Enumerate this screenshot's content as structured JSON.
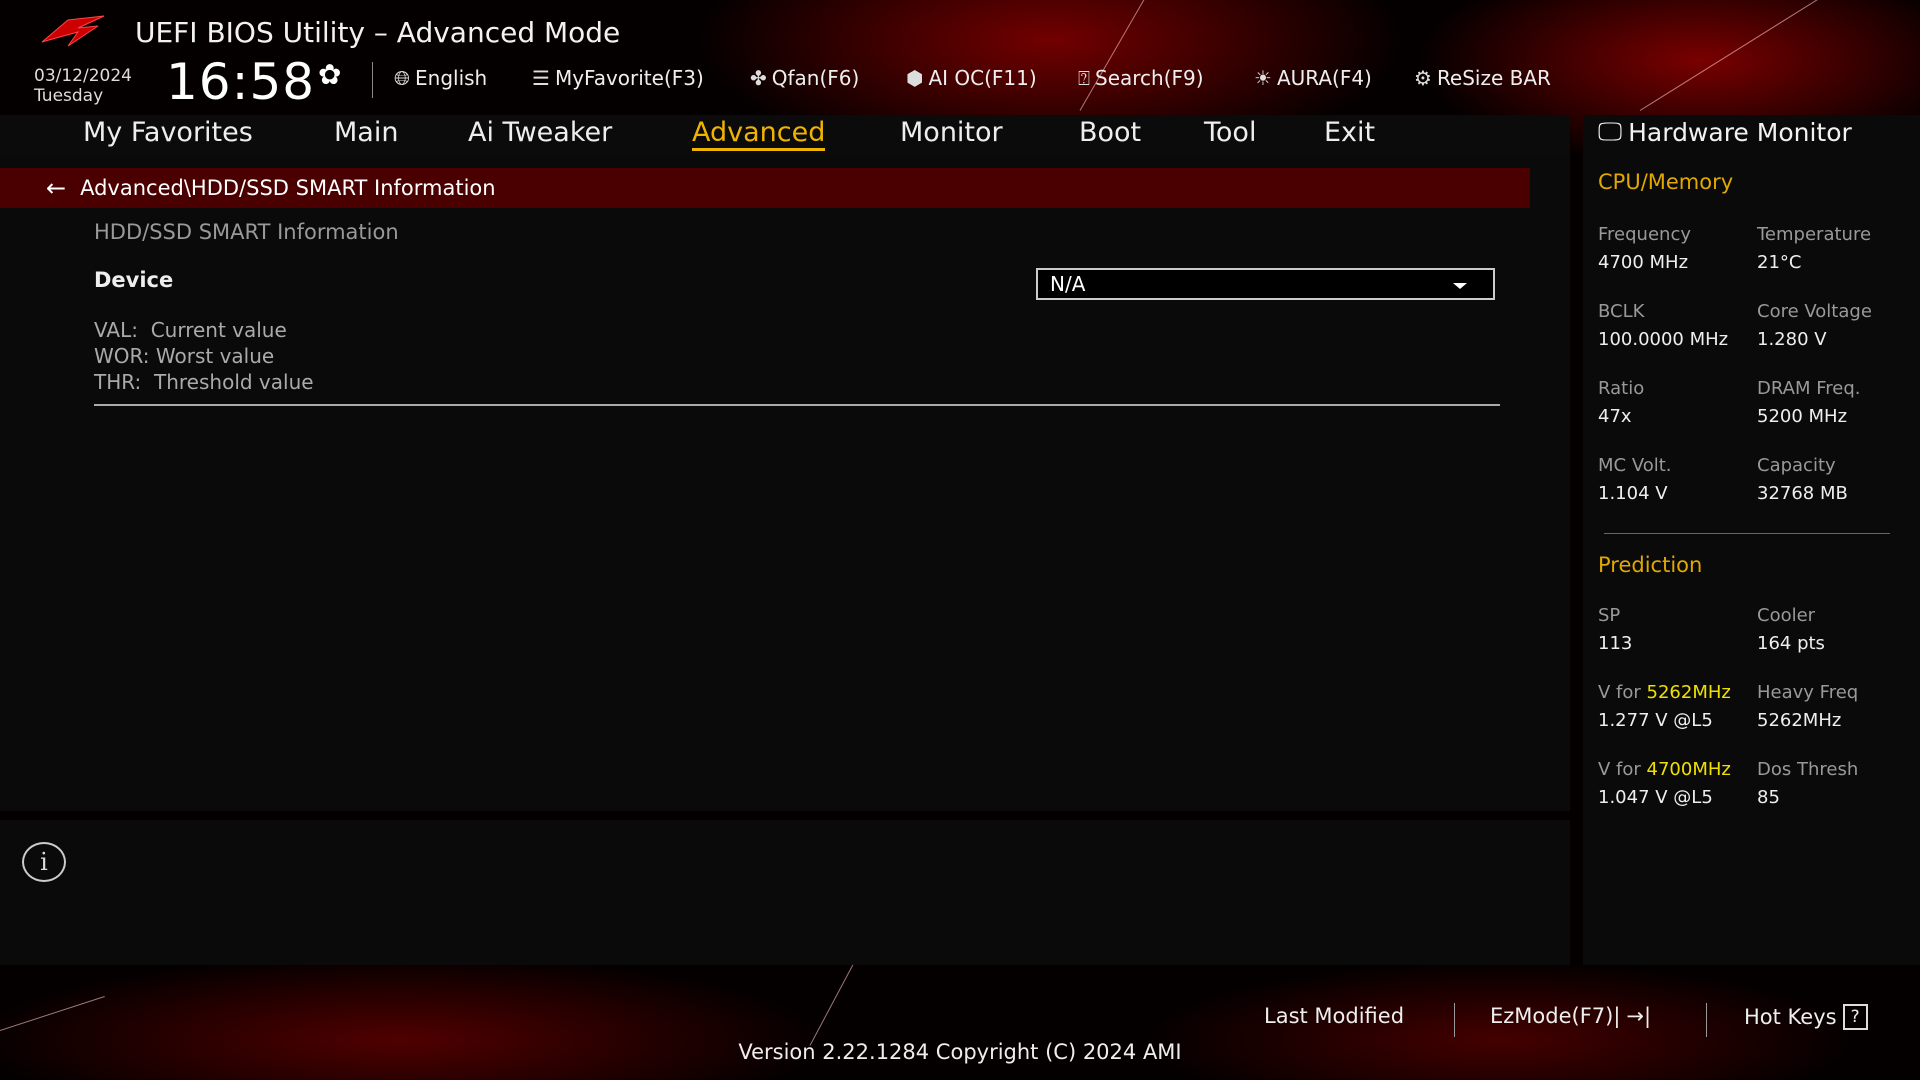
{
  "header": {
    "title": "UEFI BIOS Utility – Advanced Mode",
    "date": "03/12/2024",
    "day": "Tuesday",
    "time": "16:58"
  },
  "toolbar": [
    {
      "icon": "globe-icon",
      "label": "English"
    },
    {
      "icon": "favorite-icon",
      "label": "MyFavorite(F3)"
    },
    {
      "icon": "fan-icon",
      "label": "Qfan(F6)"
    },
    {
      "icon": "ai-oc-icon",
      "label": "AI OC(F11)"
    },
    {
      "icon": "search-icon",
      "label": "Search(F9)"
    },
    {
      "icon": "aura-icon",
      "label": "AURA(F4)"
    },
    {
      "icon": "resize-bar-icon",
      "label": "ReSize BAR"
    }
  ],
  "tabs": [
    "My Favorites",
    "Main",
    "Ai Tweaker",
    "Advanced",
    "Monitor",
    "Boot",
    "Tool",
    "Exit"
  ],
  "active_tab": "Advanced",
  "breadcrumb": "Advanced\\HDD/SSD SMART Information",
  "content": {
    "subtitle": "HDD/SSD SMART Information",
    "device_label": "Device",
    "device_value": "N/A",
    "legend": [
      {
        "k": "VAL:",
        "v": "Current value"
      },
      {
        "k": "WOR:",
        "v": "Worst value"
      },
      {
        "k": "THR:",
        "v": "Threshold value"
      }
    ]
  },
  "hw": {
    "title": "Hardware Monitor",
    "cpu_title": "CPU/Memory",
    "cpu": [
      {
        "l": "Frequency",
        "v": "4700 MHz"
      },
      {
        "l": "Temperature",
        "v": "21°C"
      },
      {
        "l": "BCLK",
        "v": "100.0000 MHz"
      },
      {
        "l": "Core Voltage",
        "v": "1.280 V"
      },
      {
        "l": "Ratio",
        "v": "47x"
      },
      {
        "l": "DRAM Freq.",
        "v": "5200 MHz"
      },
      {
        "l": "MC Volt.",
        "v": "1.104 V"
      },
      {
        "l": "Capacity",
        "v": "32768 MB"
      }
    ],
    "pred_title": "Prediction",
    "pred": {
      "sp_l": "SP",
      "sp_v": "113",
      "cooler_l": "Cooler",
      "cooler_v": "164 pts",
      "vfor": "V for ",
      "f1": "5262MHz",
      "v1": "1.277 V @L5",
      "heavy_l": "Heavy Freq",
      "heavy_v": "5262MHz",
      "f2": "4700MHz",
      "v2": "1.047 V @L5",
      "dos_l": "Dos Thresh",
      "dos_v": "85"
    }
  },
  "footer": {
    "last_modified": "Last Modified",
    "ezmode": "EzMode(F7)|",
    "ezmode_icon": "→|",
    "hotkeys": "Hot Keys",
    "hotkeys_icon": "?",
    "version": "Version 2.22.1284 Copyright (C) 2024 AMI"
  }
}
